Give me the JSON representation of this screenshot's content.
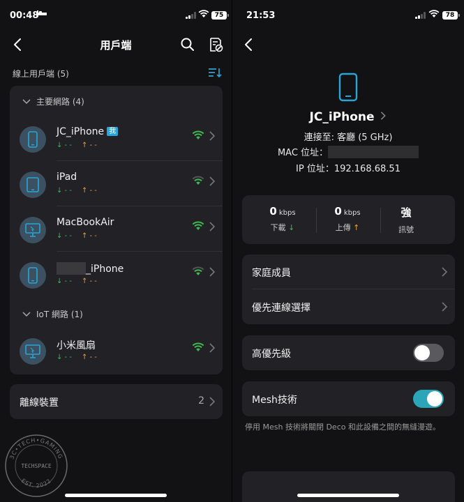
{
  "left": {
    "status": {
      "time": "00:48",
      "battery": "75"
    },
    "nav_title": "用戶端",
    "online_label": "線上用戶端 (5)",
    "main_group": "主要網路 (4)",
    "iot_group": "IoT 網路 (1)",
    "devices": [
      {
        "name": "JC_iPhone",
        "badge": "我",
        "down": "↓ - -",
        "up": "↑ - -",
        "icon": "iphone-icon"
      },
      {
        "name": "iPad",
        "down": "↓ - -",
        "up": "↑ - -",
        "icon": "ipad-icon"
      },
      {
        "name": "MacBookAir",
        "down": "↓ - -",
        "up": "↑ - -",
        "icon": "monitor-icon"
      },
      {
        "name": "_iPhone",
        "down": "↓ - -",
        "up": "↑ - -",
        "icon": "iphone-icon"
      }
    ],
    "iot_devices": [
      {
        "name": "小米風扇",
        "down": "↓ - -",
        "up": "↑ - -",
        "icon": "monitor-icon"
      }
    ],
    "offline_label": "離線裝置",
    "offline_count": "2"
  },
  "right": {
    "status": {
      "time": "21:53",
      "battery": "78"
    },
    "device_name": "JC_iPhone",
    "connected_to": "連接至: 客廳 (5 GHz)",
    "mac_label": "MAC 位址：",
    "ip_label": "IP 位址：192.168.68.51",
    "download": {
      "value": "0",
      "unit": "kbps",
      "label": "下載"
    },
    "upload": {
      "value": "0",
      "unit": "kbps",
      "label": "上傳"
    },
    "signal": {
      "value": "強",
      "label": "訊號"
    },
    "family_label": "家庭成員",
    "priority_conn_label": "優先連線選擇",
    "high_priority_label": "高優先級",
    "high_priority_on": false,
    "mesh_label": "Mesh技術",
    "mesh_on": true,
    "mesh_hint": "停用 Mesh 技術將關閉 Deco 和此設備之間的無縫漫遊。"
  },
  "watermark": {
    "top": "3C•TECH•GAMING",
    "middle": "TECHSPACE",
    "bottom": "EST. 2022"
  },
  "colors": {
    "accent": "#2aa6d6",
    "wifi": "#3fb950",
    "up_arrow": "#e8a33a",
    "toggle_on": "#2aa6b8"
  }
}
